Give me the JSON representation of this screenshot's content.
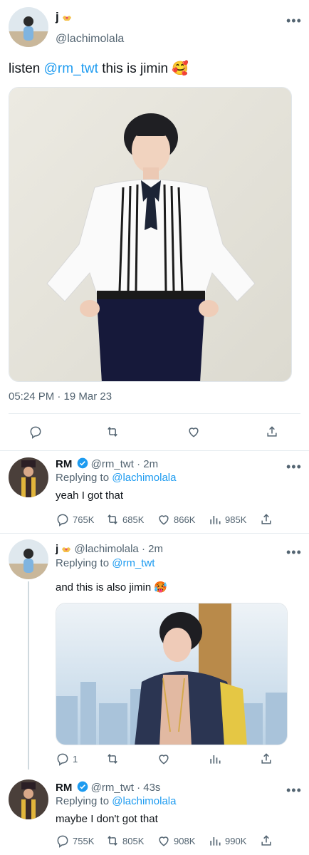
{
  "main_tweet": {
    "display_name": "j",
    "handle": "@lachimolala",
    "text_prefix": "listen ",
    "mention": "@rm_twt",
    "text_suffix": " this is jimin",
    "emoji": "🥰",
    "timestamp": "05:24 PM · 19 Mar 23"
  },
  "replies": [
    {
      "display_name": "RM",
      "handle": "@rm_twt",
      "time": "· 2m",
      "replying_label": "Replying to",
      "replying_to": "@lachimolala",
      "text": "yeah I got that",
      "replies": "765K",
      "retweets": "685K",
      "likes": "866K",
      "views": "985K"
    },
    {
      "display_name": "j",
      "handle": "@lachimolala",
      "time": "· 2m",
      "replying_label": "Replying to",
      "replying_to": "@rm_twt",
      "text": "and this is also jimin",
      "emoji": "🥵",
      "replies": "1",
      "retweets": "",
      "likes": "",
      "views": ""
    },
    {
      "display_name": "RM",
      "handle": "@rm_twt",
      "time": "· 43s",
      "replying_label": "Replying to",
      "replying_to": "@lachimolala",
      "text": "maybe I don't got that",
      "replies": "755K",
      "retweets": "805K",
      "likes": "908K",
      "views": "990K"
    }
  ],
  "colors": {
    "accent": "#1d9bf0",
    "muted": "#536471",
    "text": "#0f1419",
    "divider": "#e6ecf0"
  },
  "icons": [
    "reply-icon",
    "retweet-icon",
    "like-icon",
    "share-icon",
    "views-icon",
    "verified-icon",
    "more-icon"
  ]
}
